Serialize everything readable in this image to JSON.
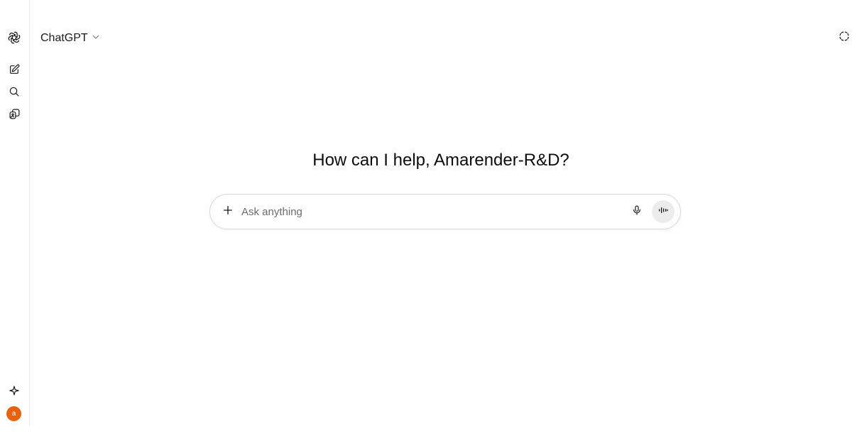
{
  "header": {
    "model_name": "ChatGPT"
  },
  "main": {
    "greeting": "How can I help, Amarender-R&D?"
  },
  "composer": {
    "placeholder": "Ask anything",
    "value": ""
  },
  "user": {
    "avatar_initial": "a",
    "avatar_color": "#e8620c"
  },
  "icons": {
    "logo": "openai-logo-icon",
    "new_chat": "edit-icon",
    "search": "search-icon",
    "library": "library-icon",
    "explore": "sparkle-icon",
    "temporary_chat": "dashed-circle-icon",
    "attach": "plus-icon",
    "dictate": "microphone-icon",
    "voice_mode": "audio-wave-icon",
    "model_menu": "chevron-down-icon"
  }
}
